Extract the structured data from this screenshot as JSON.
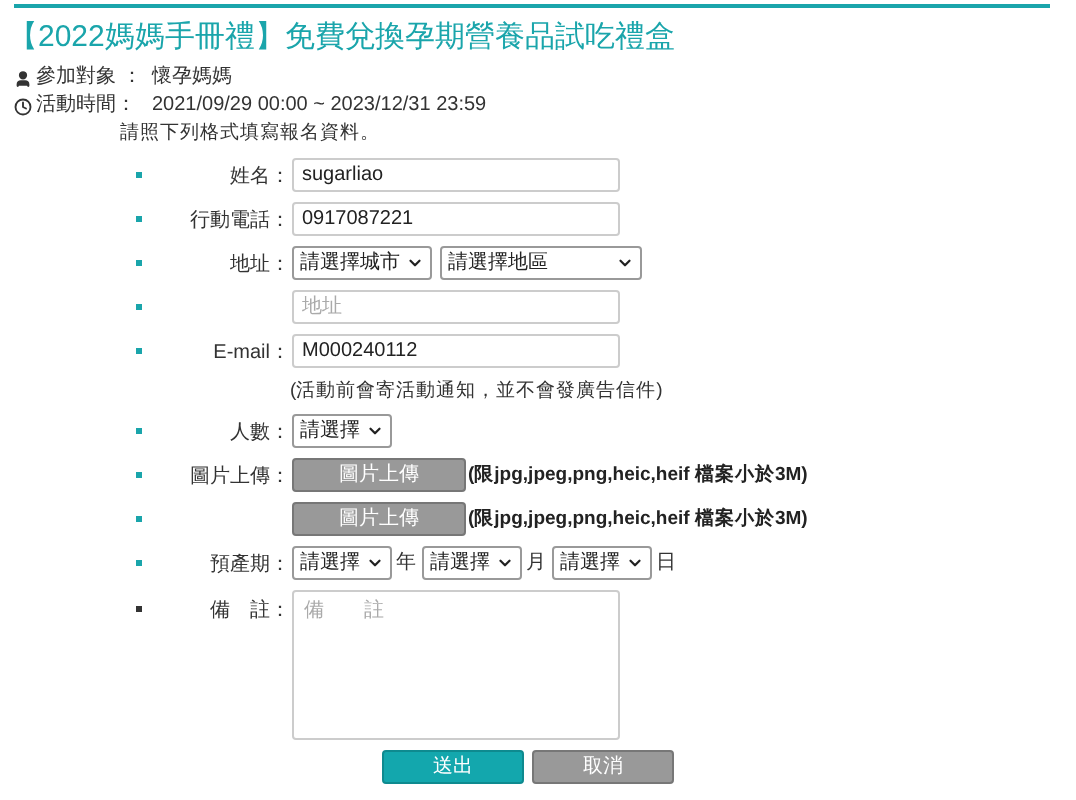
{
  "title": "【2022媽媽手冊禮】免費兌換孕期營養品試吃禮盒",
  "info": [
    {
      "kind": "person",
      "label": "參加對象 ：",
      "value": "懷孕媽媽"
    },
    {
      "kind": "clock",
      "label": "活動時間：",
      "value": "2021/09/29 00:00 ~ 2023/12/31 23:59"
    }
  ],
  "instruction": "請照下列格式填寫報名資料。",
  "fields": [
    {
      "kind": "text",
      "required": true,
      "label": "姓名：",
      "value": "sugarliao"
    },
    {
      "kind": "text",
      "required": true,
      "label": "行動電話：",
      "value": "0917087221"
    },
    {
      "kind": "selects",
      "required": true,
      "label": "地址：",
      "selects": [
        {
          "value": "請選擇城市",
          "wide": false
        },
        {
          "value": "請選擇地區",
          "wide": true
        }
      ]
    },
    {
      "kind": "text",
      "required": true,
      "placeholder": "地址"
    },
    {
      "kind": "text",
      "required": true,
      "label": "E-mail：",
      "value": "M000240112",
      "note": "(活動前會寄活動通知，並不會發廣告信件)"
    },
    {
      "kind": "selects",
      "required": true,
      "label": "人數：",
      "selects": [
        {
          "value": "請選擇",
          "wide": false
        }
      ]
    },
    {
      "kind": "upload",
      "required": true,
      "label": "圖片上傳：",
      "button": "圖片上傳",
      "hint": "(限jpg,jpeg,png,heic,heif 檔案小於3M)"
    },
    {
      "kind": "upload",
      "required": true,
      "button": "圖片上傳",
      "hint": "(限jpg,jpeg,png,heic,heif 檔案小於3M)"
    },
    {
      "kind": "date",
      "required": true,
      "label": "預產期：",
      "parts": [
        {
          "value": "請選擇",
          "unit": "年"
        },
        {
          "value": "請選擇",
          "unit": "月"
        },
        {
          "value": "請選擇",
          "unit": "日"
        }
      ]
    },
    {
      "kind": "textarea",
      "required": false,
      "label": "備　註：",
      "placeholder": "備　　註"
    }
  ],
  "buttons": [
    {
      "kind": "submit",
      "label": "送出"
    },
    {
      "kind": "cancel",
      "label": "取消"
    }
  ]
}
